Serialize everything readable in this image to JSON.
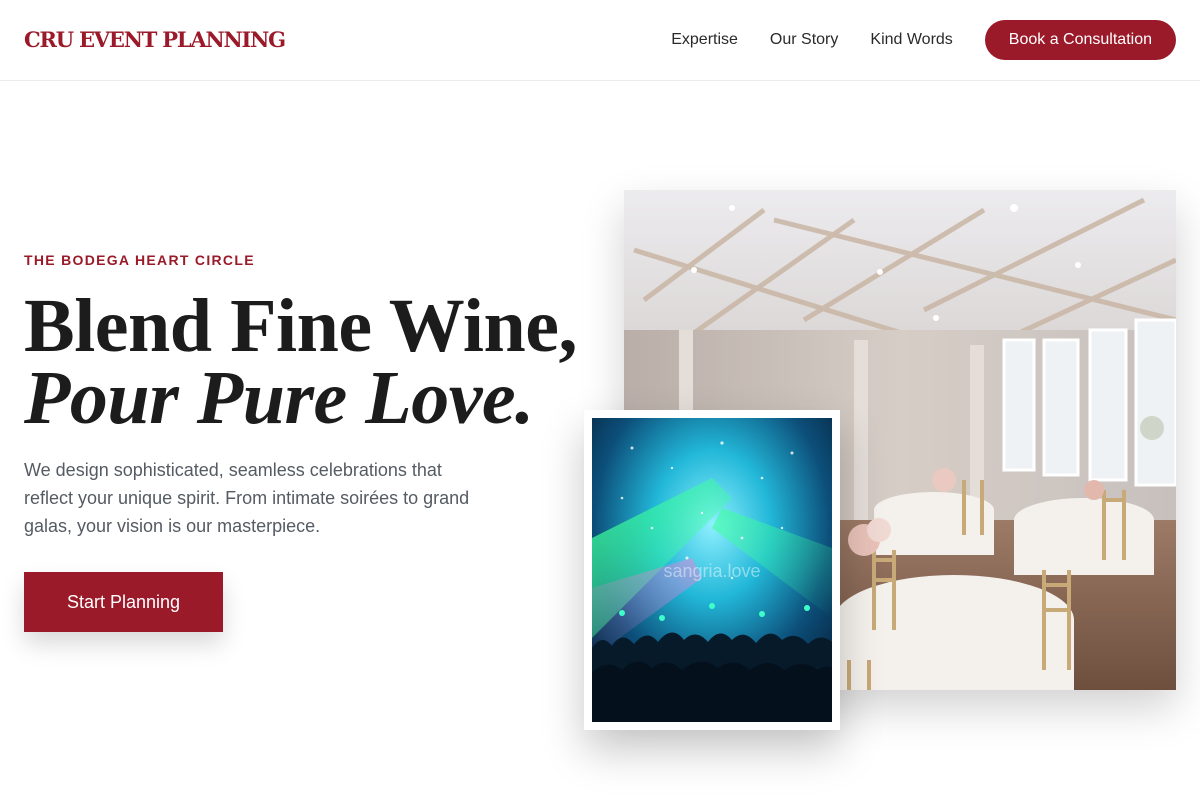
{
  "brand": {
    "name": "CRU EVENT PLANNING",
    "accent_color": "#9b1a2a"
  },
  "nav": {
    "items": [
      {
        "label": "Expertise"
      },
      {
        "label": "Our Story"
      },
      {
        "label": "Kind Words"
      }
    ],
    "cta_label": "Book a Consultation"
  },
  "hero": {
    "eyebrow": "THE BODEGA HEART CIRCLE",
    "headline_line1": "Blend Fine Wine,",
    "headline_line2": "Pour Pure Love.",
    "lead": "We design sophisticated, seamless celebrations that reflect your unique spirit. From intimate soirées to grand galas, your vision is our masterpiece.",
    "button_label": "Start Planning"
  },
  "images": {
    "main_photo": "banquet-hall-photo",
    "inset_photo": "concert-crowd-photo",
    "inset_watermark": "sangria.love"
  }
}
